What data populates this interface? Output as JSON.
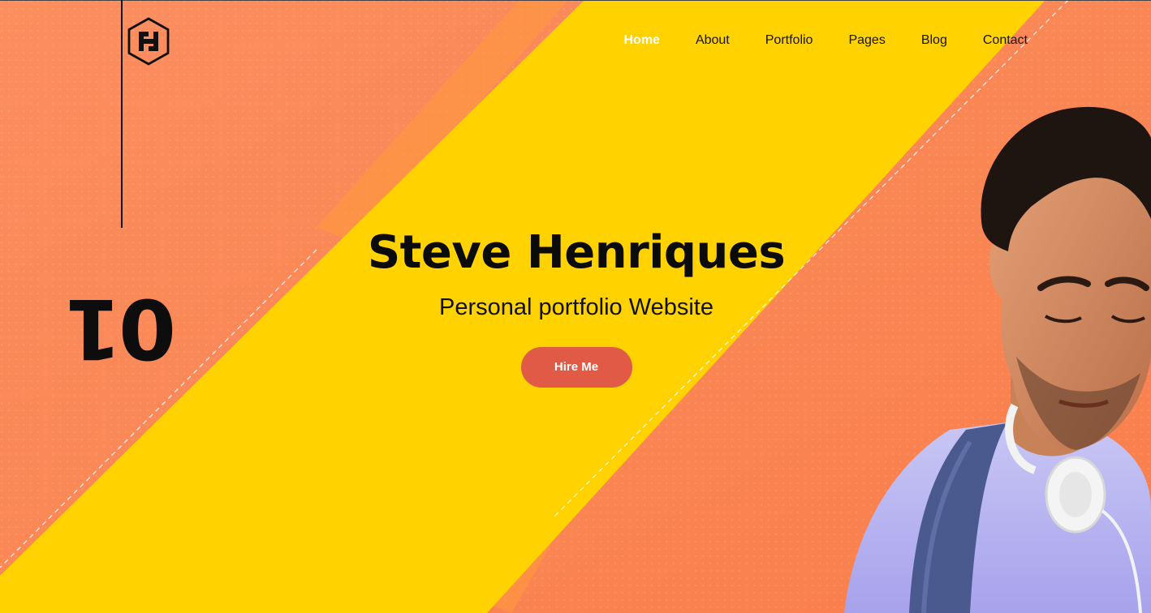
{
  "brand": {
    "logo_icon": "hexagon-h-logo-icon"
  },
  "nav": {
    "items": [
      {
        "label": "Home",
        "active": true
      },
      {
        "label": "About",
        "active": false
      },
      {
        "label": "Portfolio",
        "active": false
      },
      {
        "label": "Pages",
        "active": false
      },
      {
        "label": "Blog",
        "active": false
      },
      {
        "label": "Contact",
        "active": false
      }
    ]
  },
  "slide": {
    "number": "01"
  },
  "hero": {
    "title": "Steve Henriques",
    "subtitle": "Personal portfolio Website",
    "cta_label": "Hire Me"
  },
  "colors": {
    "background_orange": "#fb8a5a",
    "accent_yellow": "#ffd200",
    "button_red": "#e05a45",
    "text_dark": "#111111",
    "nav_active": "#ffffff"
  }
}
